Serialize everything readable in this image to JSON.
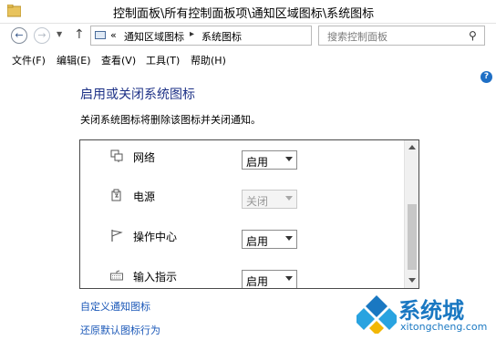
{
  "window": {
    "title": "控制面板\\所有控制面板项\\通知区域图标\\系统图标"
  },
  "address": {
    "overflow": "«",
    "crumbs": [
      "通知区域图标",
      "系统图标"
    ],
    "search_placeholder": "搜索控制面板"
  },
  "menu": [
    "文件(F)",
    "编辑(E)",
    "查看(V)",
    "工具(T)",
    "帮助(H)"
  ],
  "main": {
    "heading": "启用或关闭系统图标",
    "description": "关闭系统图标将删除该图标并关闭通知。",
    "rows": [
      {
        "label": "网络",
        "value": "启用",
        "enabled": true,
        "icon": "network-icon"
      },
      {
        "label": "电源",
        "value": "关闭",
        "enabled": false,
        "icon": "power-icon"
      },
      {
        "label": "操作中心",
        "value": "启用",
        "enabled": true,
        "icon": "action-center-flag-icon"
      },
      {
        "label": "输入指示",
        "value": "启用",
        "enabled": true,
        "icon": "keyboard-icon"
      }
    ],
    "links": [
      "自定义通知图标",
      "还原默认图标行为"
    ]
  },
  "watermark": {
    "name": "系统城",
    "url": "xitongcheng.com"
  },
  "colors": {
    "heading": "#1e3287",
    "link": "#1b58b8",
    "watermark": "#1a78c2"
  }
}
